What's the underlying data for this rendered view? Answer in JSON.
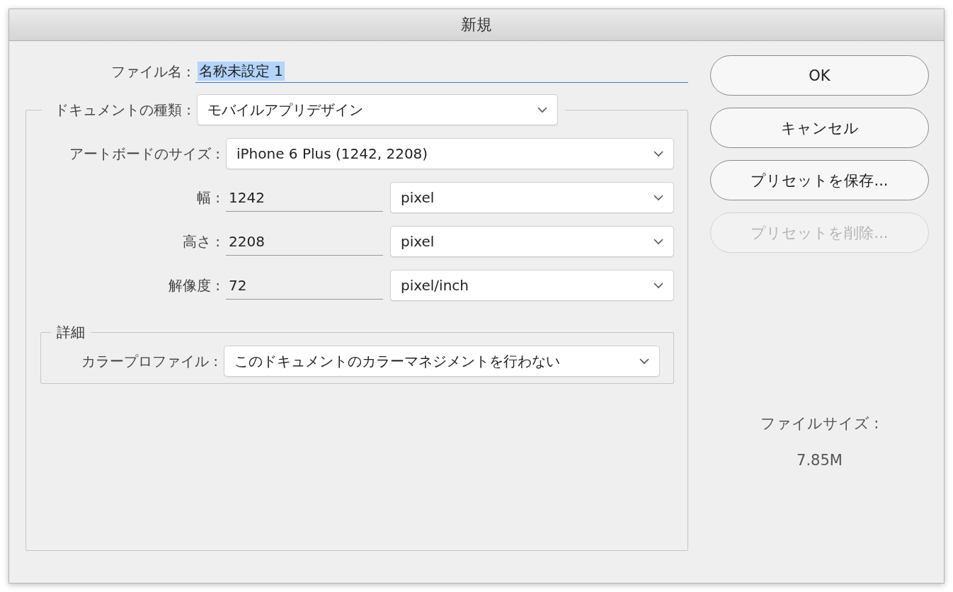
{
  "window": {
    "title": "新規"
  },
  "file_name": {
    "label": "ファイル名 :",
    "value": "名称未設定 1",
    "text_selected": true
  },
  "document_type": {
    "label": "ドキュメントの種類 :",
    "value": "モバイルアプリデザイン"
  },
  "fields": [
    {
      "kind": "dropdown",
      "label": "アートボードのサイズ :",
      "value": "iPhone 6 Plus (1242, 2208)"
    },
    {
      "kind": "number",
      "label": "幅 :",
      "value": "1242",
      "unit": "pixel"
    },
    {
      "kind": "number",
      "label": "高さ :",
      "value": "2208",
      "unit": "pixel"
    },
    {
      "kind": "number",
      "label": "解像度 :",
      "value": "72",
      "unit": "pixel/inch"
    }
  ],
  "details": {
    "title": "詳細",
    "fields": [
      {
        "kind": "dropdown",
        "label": "カラープロファイル :",
        "value": "このドキュメントのカラーマネジメントを行わない"
      }
    ]
  },
  "buttons": [
    {
      "label": "OK",
      "disabled": false
    },
    {
      "label": "キャンセル",
      "disabled": false
    },
    {
      "label": "プリセットを保存...",
      "disabled": false
    },
    {
      "label": "プリセットを削除...",
      "disabled": true
    }
  ],
  "file_size": {
    "label": "ファイルサイズ :",
    "value": "7.85M"
  }
}
